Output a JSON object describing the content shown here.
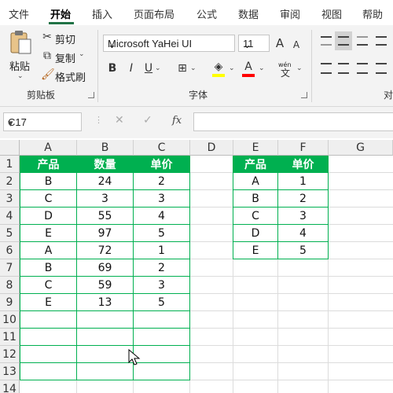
{
  "menu": {
    "tabs": [
      "文件",
      "开始",
      "插入",
      "页面布局",
      "公式",
      "数据",
      "审阅",
      "视图",
      "帮助"
    ],
    "active": "开始"
  },
  "clipboard": {
    "paste_label": "粘贴",
    "cut_label": "剪切",
    "copy_label": "复制",
    "format_painter_label": "格式刷",
    "group_label": "剪贴板"
  },
  "font": {
    "font_name": "Microsoft YaHei UI",
    "font_size": "11",
    "bold": "B",
    "italic": "I",
    "underline": "U",
    "grow": "A",
    "shrink": "A",
    "phonetic": "wén",
    "group_label": "字体",
    "highlight_color": "#ffff00",
    "font_color": "#ff0000"
  },
  "alignment": {
    "group_label_partial": "对"
  },
  "formula_bar": {
    "name_box": "C17",
    "fx_label": "fx",
    "value": ""
  },
  "columns": [
    "A",
    "B",
    "C",
    "D",
    "E",
    "F",
    "G"
  ],
  "rows": [
    "1",
    "2",
    "3",
    "4",
    "5",
    "6",
    "7",
    "8",
    "9",
    "10",
    "11",
    "12",
    "13",
    "14"
  ],
  "table1": {
    "headers": [
      "产品",
      "数量",
      "单价"
    ],
    "rows": [
      [
        "B",
        "24",
        "2"
      ],
      [
        "C",
        "3",
        "3"
      ],
      [
        "D",
        "55",
        "4"
      ],
      [
        "E",
        "97",
        "5"
      ],
      [
        "A",
        "72",
        "1"
      ],
      [
        "B",
        "69",
        "2"
      ],
      [
        "C",
        "59",
        "3"
      ],
      [
        "E",
        "13",
        "5"
      ],
      [
        "",
        "",
        ""
      ],
      [
        "",
        "",
        ""
      ],
      [
        "",
        "",
        ""
      ],
      [
        "",
        "",
        ""
      ]
    ]
  },
  "table2": {
    "headers": [
      "产品",
      "单价"
    ],
    "rows": [
      [
        "A",
        "1"
      ],
      [
        "B",
        "2"
      ],
      [
        "C",
        "3"
      ],
      [
        "D",
        "4"
      ],
      [
        "E",
        "5"
      ]
    ]
  },
  "colors": {
    "header_fill": "#00b050",
    "accent": "#217346"
  }
}
